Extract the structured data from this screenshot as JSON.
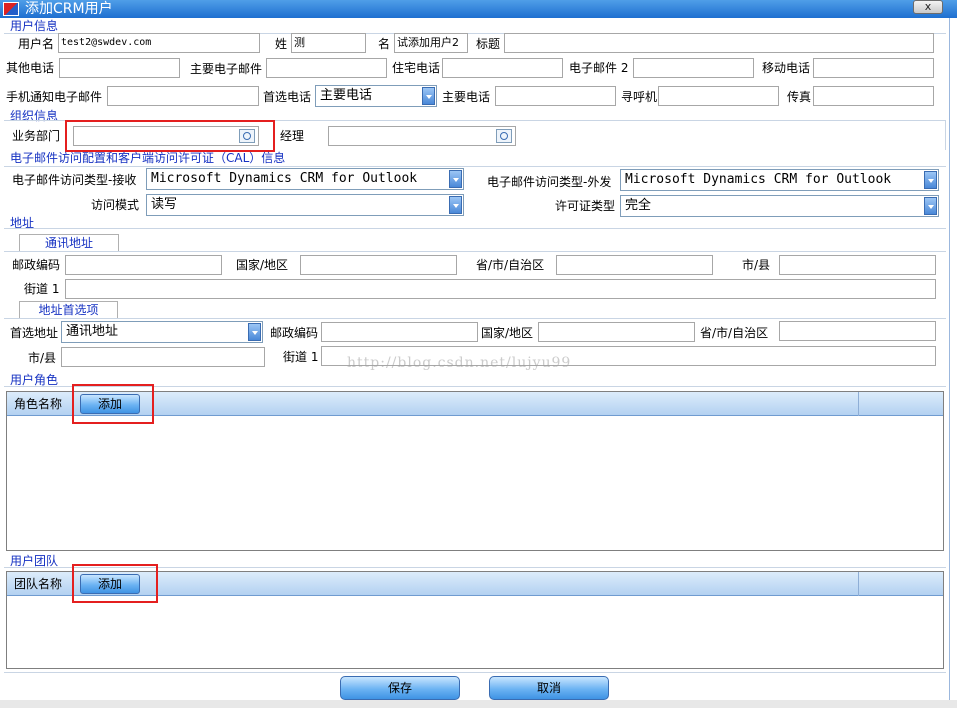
{
  "window": {
    "title": "添加CRM用户",
    "close_label": "x"
  },
  "user_info": {
    "section_title": "用户信息",
    "username_label": "用户名",
    "username_value": "test2@swdev.com",
    "lastname_label": "姓",
    "lastname_value": "测",
    "firstname_label": "名",
    "firstname_value": "试添加用户2",
    "title_label": "标题",
    "title_value": "",
    "other_phone_label": "其他电话",
    "primary_email_label": "主要电子邮件",
    "home_phone_label": "住宅电话",
    "email2_label": "电子邮件 2",
    "mobile_label": "移动电话",
    "mobile_alert_email_label": "手机通知电子邮件",
    "preferred_phone_label": "首选电话",
    "preferred_phone_value": "主要电话",
    "main_phone_label": "主要电话",
    "pager_label": "寻呼机",
    "fax_label": "传真"
  },
  "org_info": {
    "section_title": "组织信息",
    "business_unit_label": "业务部门",
    "manager_label": "经理"
  },
  "email_cal": {
    "section_title": "电子邮件访问配置和客户端访问许可证（CAL）信息",
    "incoming_label": "电子邮件访问类型-接收",
    "incoming_value": "Microsoft Dynamics CRM for Outlook",
    "outgoing_label": "电子邮件访问类型-外发",
    "outgoing_value": "Microsoft Dynamics CRM for Outlook",
    "access_mode_label": "访问模式",
    "access_mode_value": "读写",
    "license_type_label": "许可证类型",
    "license_type_value": "完全"
  },
  "address": {
    "section_title": "地址",
    "mailing_tab": "通讯地址",
    "postal_code_label": "邮政编码",
    "country_label": "国家/地区",
    "state_label": "省/市/自治区",
    "city_label": "市/县",
    "street1_label": "街道 1",
    "pref_tab": "地址首选项",
    "pref_address_label": "首选地址",
    "pref_address_value": "通讯地址",
    "pref_postal_label": "邮政编码",
    "pref_country_label": "国家/地区",
    "pref_state_label": "省/市/自治区",
    "pref_city_label": "市/县",
    "pref_street1_label": "街道 1"
  },
  "roles": {
    "section_title": "用户角色",
    "column_label": "角色名称",
    "add_label": "添加"
  },
  "teams": {
    "section_title": "用户团队",
    "column_label": "团队名称",
    "add_label": "添加"
  },
  "footer": {
    "save_label": "保存",
    "cancel_label": "取消"
  },
  "watermark": "http://blog.csdn.net/lujyu99",
  "colors": {
    "section_title": "#1531c2",
    "highlight_box": "#e41f1f",
    "title_bar": "#1e6fd0"
  }
}
